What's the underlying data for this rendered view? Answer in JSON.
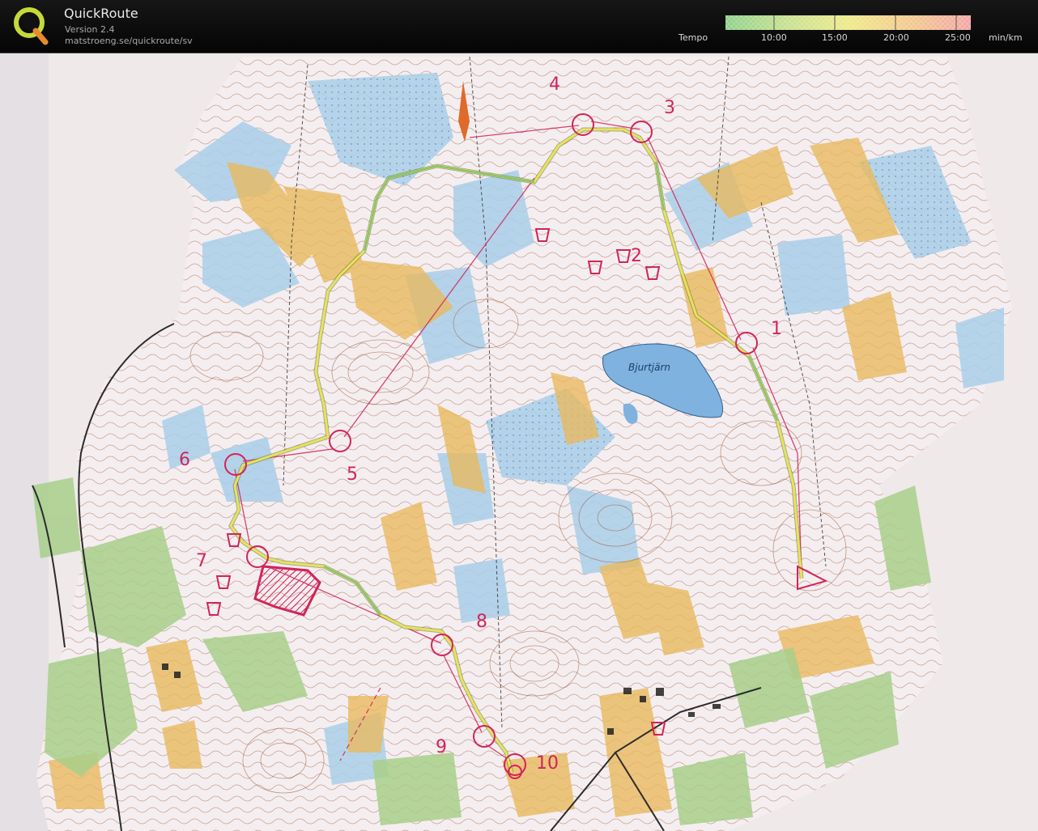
{
  "app": {
    "title": "QuickRoute",
    "version": "Version 2.4",
    "url": "matstroeng.se/quickroute/sv"
  },
  "tempo": {
    "label": "Tempo",
    "unit": "min/km",
    "ticks": [
      "10:00",
      "15:00",
      "20:00",
      "25:00"
    ],
    "gradient": [
      "#8fd18a",
      "#c7e08f",
      "#eeea88",
      "#f3c98d",
      "#f2a6a6"
    ]
  },
  "map": {
    "lake_name": "Bjurtjärn",
    "controls": [
      {
        "number": "1",
        "label": "1"
      },
      {
        "number": "2",
        "label": "2"
      },
      {
        "number": "3",
        "label": "3"
      },
      {
        "number": "4",
        "label": "4"
      },
      {
        "number": "5",
        "label": "5"
      },
      {
        "number": "6",
        "label": "6"
      },
      {
        "number": "7",
        "label": "7"
      },
      {
        "number": "8",
        "label": "8"
      },
      {
        "number": "9",
        "label": "9"
      },
      {
        "number": "10",
        "label": "10"
      }
    ],
    "colors": {
      "course": "#d1245a",
      "route_fast": "#7cc36e",
      "route_mid": "#e9e25a",
      "water": "#a9cfe9",
      "open_land": "#e9b95c",
      "forest_green": "#a8cf8a",
      "contour": "#9b5a3c",
      "paper": "#f6f1f1"
    }
  }
}
